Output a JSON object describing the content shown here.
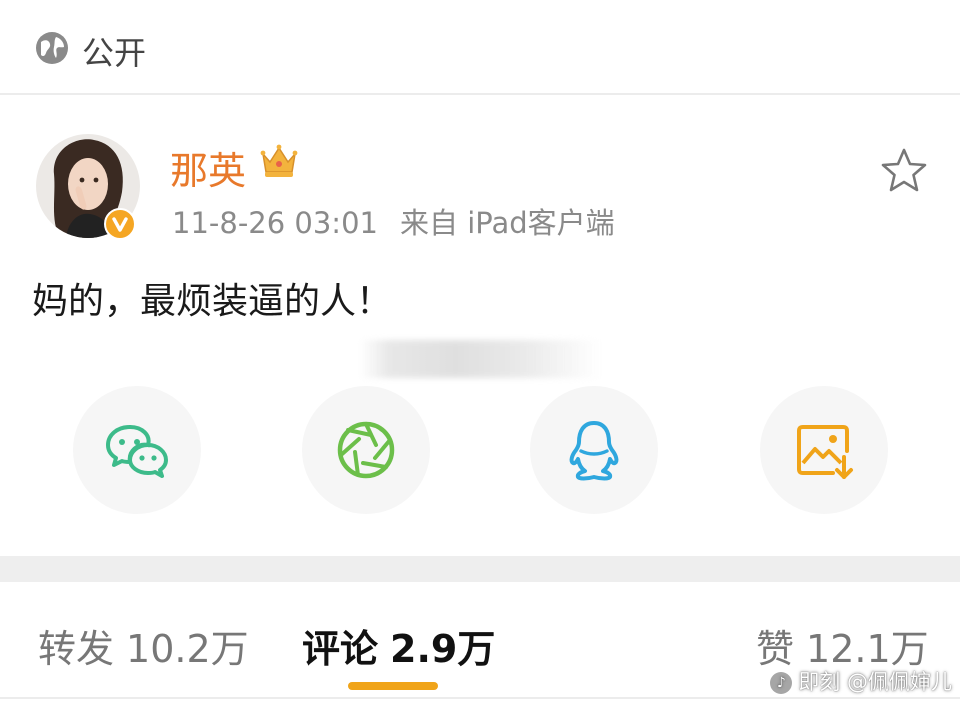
{
  "visibility": {
    "label": "公开",
    "icon": "globe-icon"
  },
  "post": {
    "author": "那英",
    "author_badge": "crown-icon",
    "verified_icon": "verified-badge-icon",
    "timestamp": "11-8-26 03:01",
    "source": "来自 iPad客户端",
    "text": "妈的，最烦装逼的人！"
  },
  "share": [
    {
      "name": "wechat",
      "icon": "wechat-icon",
      "color": "#3dbb8a"
    },
    {
      "name": "moments",
      "icon": "aperture-icon",
      "color": "#6cbf4a"
    },
    {
      "name": "qq",
      "icon": "qq-penguin-icon",
      "color": "#2fa7de"
    },
    {
      "name": "save-image",
      "icon": "save-image-icon",
      "color": "#f0a419"
    }
  ],
  "stats": {
    "repost_label": "转发",
    "repost_count": "10.2万",
    "comment_label": "评论",
    "comment_count": "2.9万",
    "like_label": "赞",
    "like_count": "12.1万",
    "active_tab": "评论",
    "accent": "#f0a419"
  },
  "watermark": {
    "text": "即刻 @佩佩婶儿"
  },
  "colors": {
    "username": "#e8792b",
    "meta": "#8a8a8a"
  }
}
